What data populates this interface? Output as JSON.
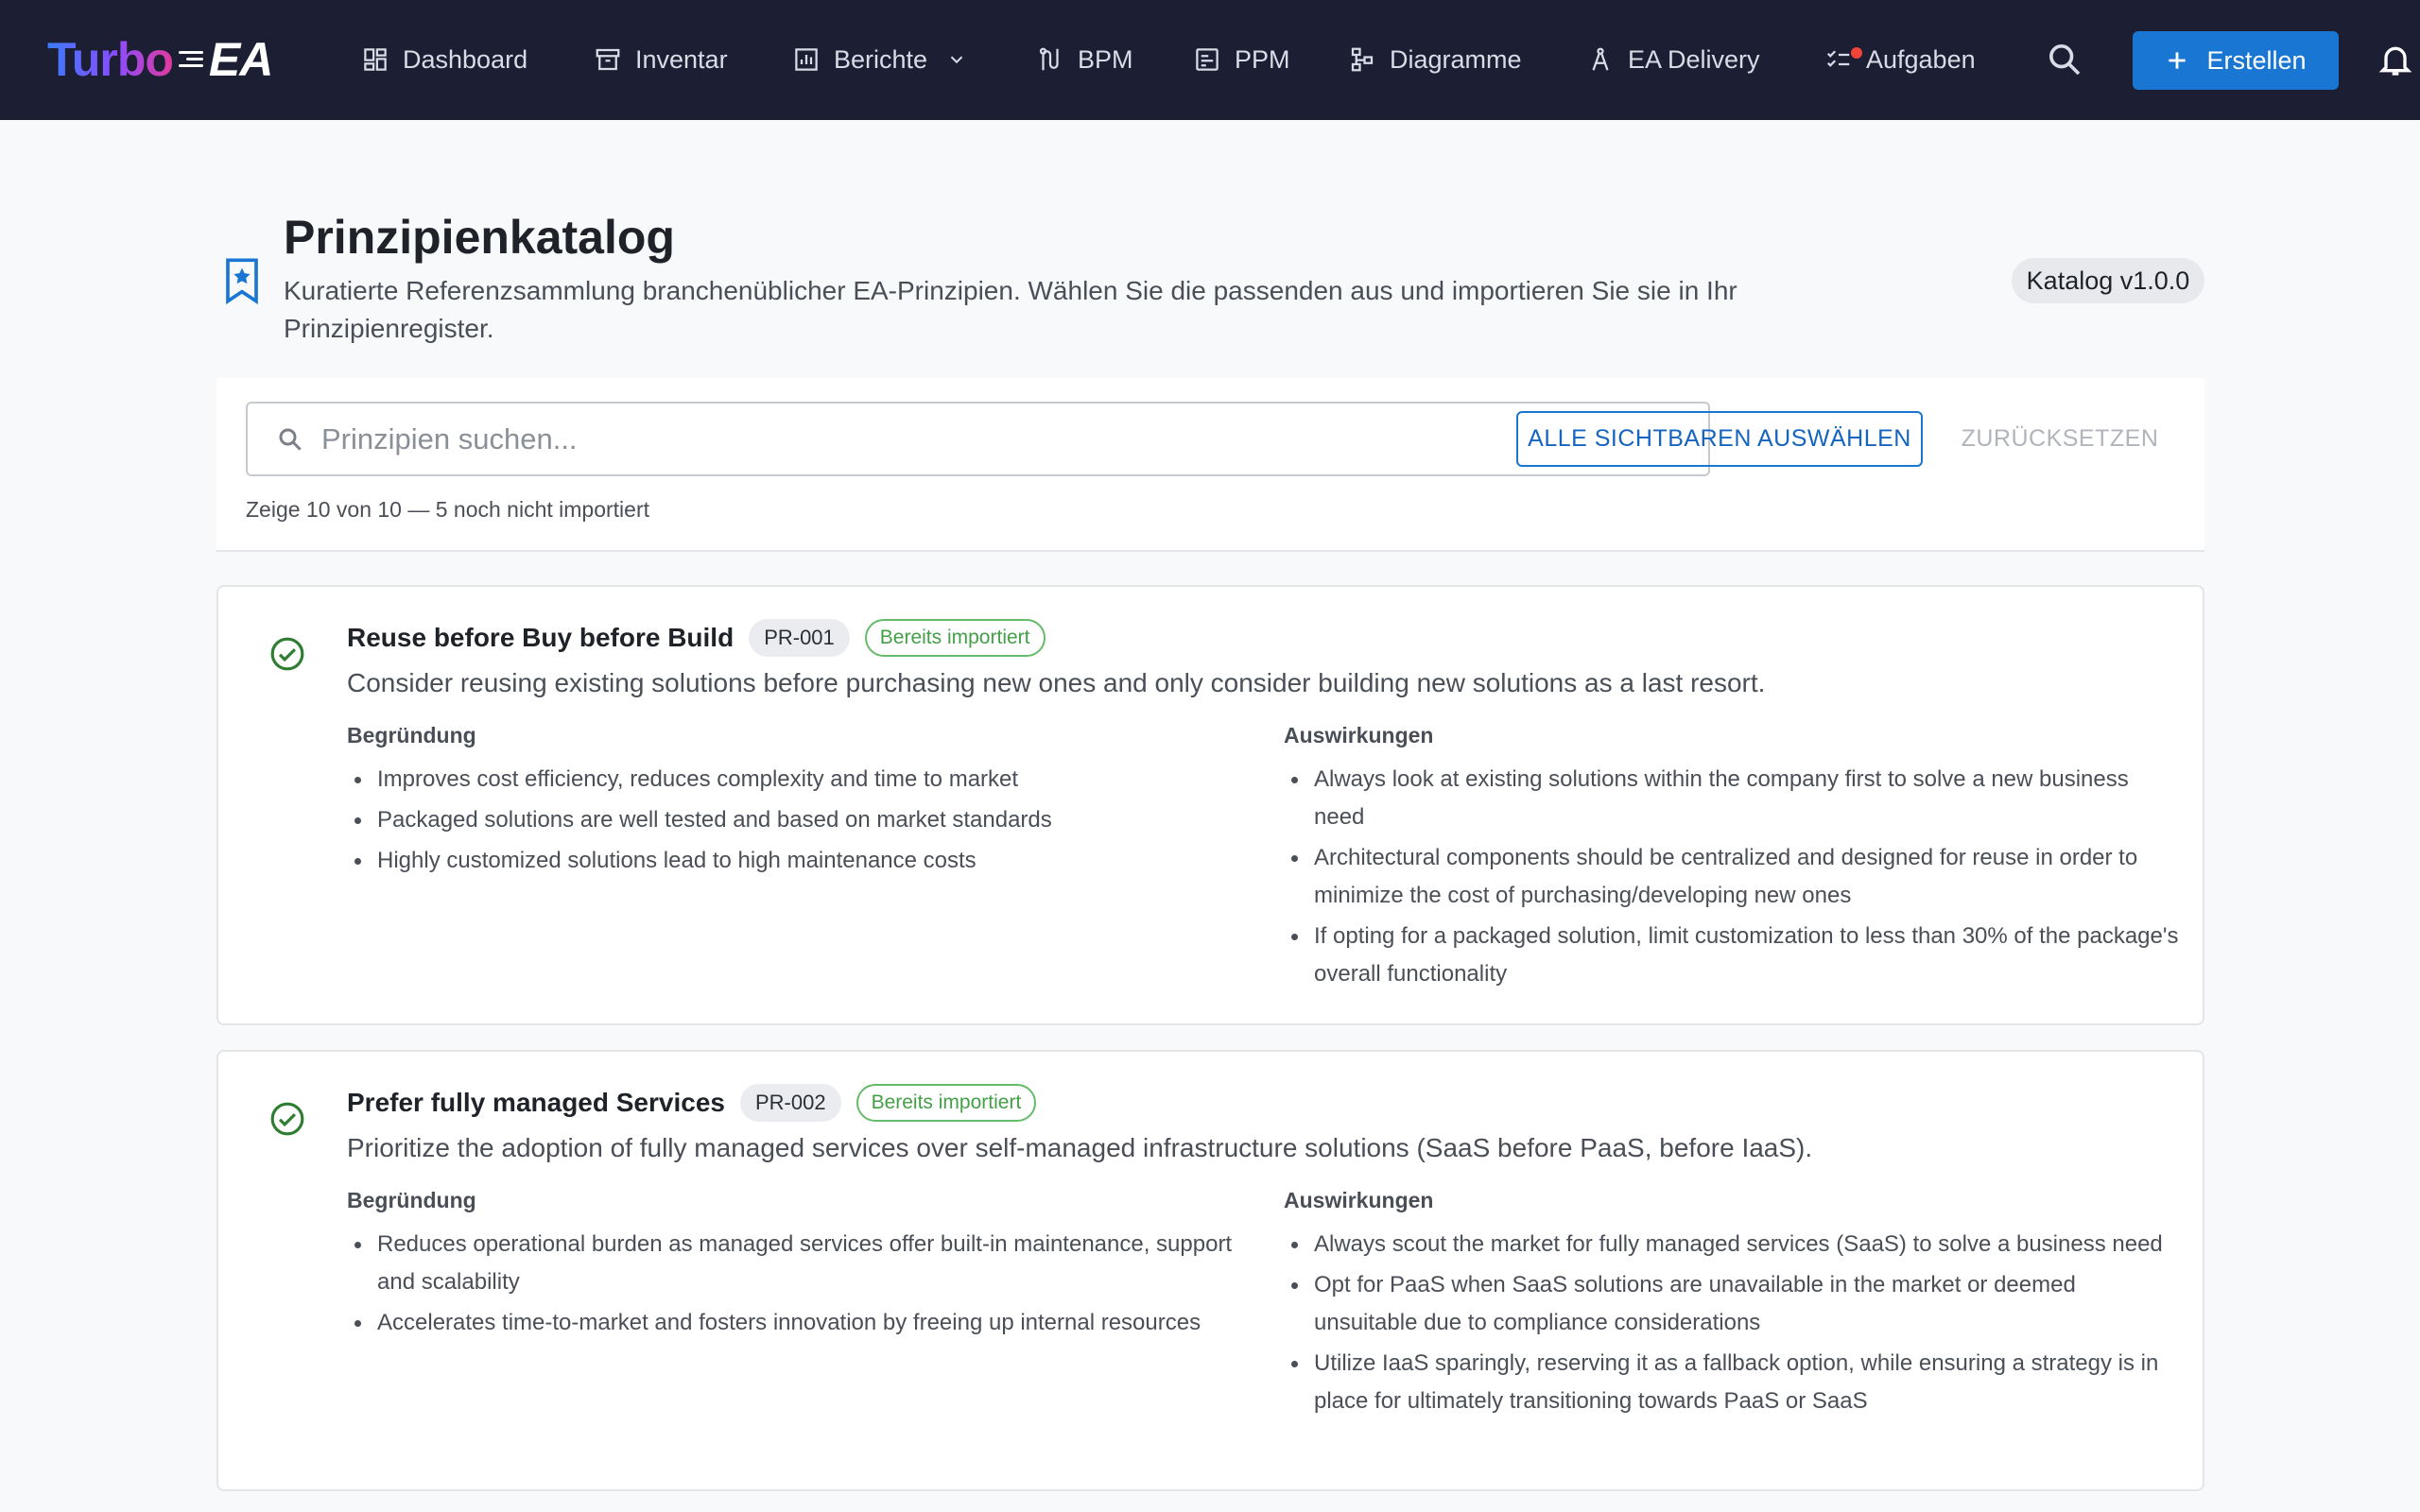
{
  "app": {
    "logo_part1": "Turbo",
    "logo_part2": "EA",
    "nav": {
      "dashboard": "Dashboard",
      "inventory": "Inventar",
      "reports": "Berichte",
      "bpm": "BPM",
      "ppm": "PPM",
      "diagrams": "Diagramme",
      "ea_delivery": "EA Delivery",
      "tasks": "Aufgaben"
    },
    "create_label": "Erstellen",
    "colors": {
      "topbar": "#1c1f33",
      "primary": "#1976d2",
      "success": "#43a047",
      "notification": "#f04438"
    }
  },
  "header": {
    "title": "Prinzipienkatalog",
    "subtitle": "Kuratierte Referenzsammlung branchenüblicher EA-Prinzipien. Wählen Sie die passenden aus und importieren Sie sie in Ihr Prinzipienregister.",
    "version": "Katalog v1.0.0"
  },
  "toolbar": {
    "search_placeholder": "Prinzipien suchen...",
    "search_value": "",
    "select_all_label": "ALLE SICHTBAREN AUSWÄHLEN",
    "reset_label": "ZURÜCKSETZEN",
    "count_text": "Zeige 10 von 10 — 5 noch nicht importiert"
  },
  "principles": [
    {
      "title": "Reuse before Buy before Build",
      "id": "PR-001",
      "status": "Bereits importiert",
      "description": "Consider reusing existing solutions before purchasing new ones and only consider building new solutions as a last resort.",
      "rationale_label": "Begründung",
      "implications_label": "Auswirkungen",
      "rationale": [
        "Improves cost efficiency, reduces complexity and time to market",
        "Packaged solutions are well tested and based on market standards",
        "Highly customized solutions lead to high maintenance costs"
      ],
      "implications": [
        "Always look at existing solutions within the company first to solve a new business need",
        "Architectural components should be centralized and designed for reuse in order to minimize the cost of purchasing/developing new ones",
        "If opting for a packaged solution, limit customization to less than 30% of the package's overall functionality"
      ]
    },
    {
      "title": "Prefer fully managed Services",
      "id": "PR-002",
      "status": "Bereits importiert",
      "description": "Prioritize the adoption of fully managed services over self-managed infrastructure solutions (SaaS before PaaS, before IaaS).",
      "rationale_label": "Begründung",
      "implications_label": "Auswirkungen",
      "rationale": [
        "Reduces operational burden as managed services offer built-in maintenance, support and scalability",
        "Accelerates time-to-market and fosters innovation by freeing up internal resources"
      ],
      "implications": [
        "Always scout the market for fully managed services (SaaS) to solve a business need",
        "Opt for PaaS when SaaS solutions are unavailable in the market or deemed unsuitable due to compliance considerations",
        "Utilize IaaS sparingly, reserving it as a fallback option, while ensuring a strategy is in place for ultimately transitioning towards PaaS or SaaS"
      ]
    }
  ]
}
